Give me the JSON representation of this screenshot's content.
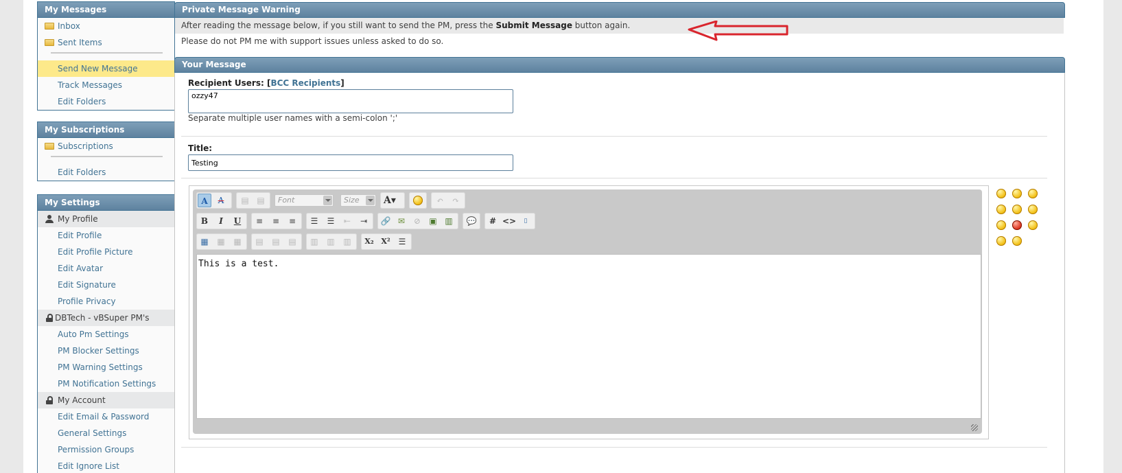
{
  "sidebar": {
    "messages": {
      "title": "My Messages",
      "inbox": "Inbox",
      "sent": "Sent Items",
      "send_new": "Send New Message",
      "track": "Track Messages",
      "edit_folders": "Edit Folders"
    },
    "subscriptions": {
      "title": "My Subscriptions",
      "subscriptions": "Subscriptions",
      "edit_folders": "Edit Folders"
    },
    "settings": {
      "title": "My Settings",
      "profile_head": "My Profile",
      "edit_profile": "Edit Profile",
      "edit_picture": "Edit Profile Picture",
      "edit_avatar": "Edit Avatar",
      "edit_signature": "Edit Signature",
      "privacy": "Profile Privacy",
      "dbtech_head": "DBTech - vBSuper PM's",
      "auto_pm": "Auto Pm Settings",
      "pm_blocker": "PM Blocker Settings",
      "pm_warning": "PM Warning Settings",
      "pm_notification": "PM Notification Settings",
      "account_head": "My Account",
      "edit_email": "Edit Email & Password",
      "general": "General Settings",
      "permission": "Permission Groups",
      "ignore": "Edit Ignore List"
    }
  },
  "warning": {
    "title": "Private Message Warning",
    "line1_pre": "After reading the message below, if you still want to send the PM, press the ",
    "line1_bold": "Submit Message",
    "line1_post": " button again.",
    "line2": "Please do not PM me with support issues unless asked to do so."
  },
  "message": {
    "title": "Your Message",
    "recipients_label": "Recipient Users:",
    "bcc_open": "[",
    "bcc_link": "BCC Recipients",
    "bcc_close": "]",
    "recipients_value": "ozzy47",
    "recipients_hint": "Separate multiple user names with a semi-colon ';'",
    "title_label": "Title:",
    "title_value": "Testing"
  },
  "editor": {
    "font_placeholder": "Font",
    "size_placeholder": "Size",
    "body": "This is a test."
  },
  "colors": {
    "header": "#5e829f",
    "link": "#417394",
    "active": "#fde98a",
    "arrow": "#d9252d"
  }
}
